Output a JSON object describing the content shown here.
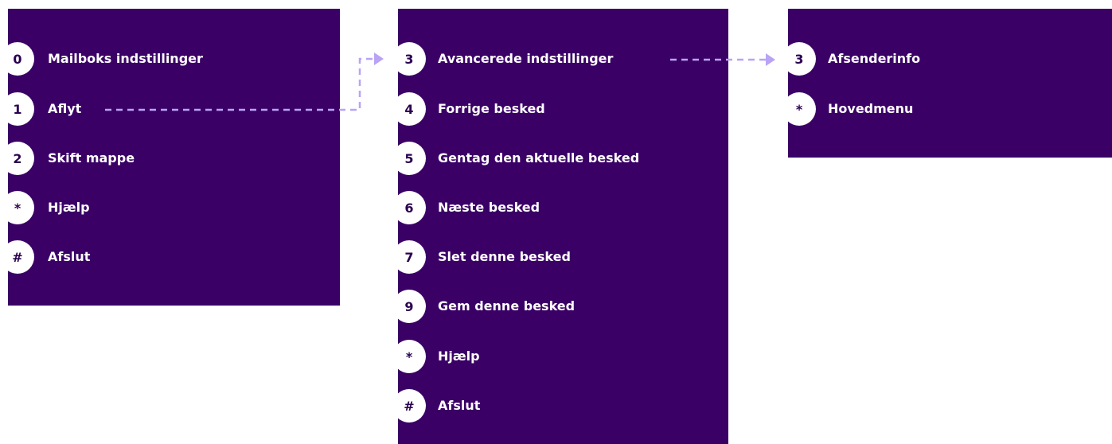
{
  "accent_color": "#3a0066",
  "connector_color": "#b9a3f5",
  "menus": {
    "main": {
      "items": [
        {
          "key": "0",
          "label": "Mailboks indstillinger"
        },
        {
          "key": "1",
          "label": "Aflyt"
        },
        {
          "key": "2",
          "label": "Skift mappe"
        },
        {
          "key": "*",
          "label": "Hjælp"
        },
        {
          "key": "#",
          "label": "Afslut"
        }
      ]
    },
    "playback": {
      "items": [
        {
          "key": "3",
          "label": "Avancerede indstillinger"
        },
        {
          "key": "4",
          "label": "Forrige besked"
        },
        {
          "key": "5",
          "label": "Gentag den aktuelle besked"
        },
        {
          "key": "6",
          "label": "Næste besked"
        },
        {
          "key": "7",
          "label": "Slet denne besked"
        },
        {
          "key": "9",
          "label": "Gem denne besked"
        },
        {
          "key": "*",
          "label": "Hjælp"
        },
        {
          "key": "#",
          "label": "Afslut"
        }
      ]
    },
    "advanced": {
      "items": [
        {
          "key": "3",
          "label": "Afsenderinfo"
        },
        {
          "key": "*",
          "label": "Hovedmenu"
        }
      ]
    }
  }
}
